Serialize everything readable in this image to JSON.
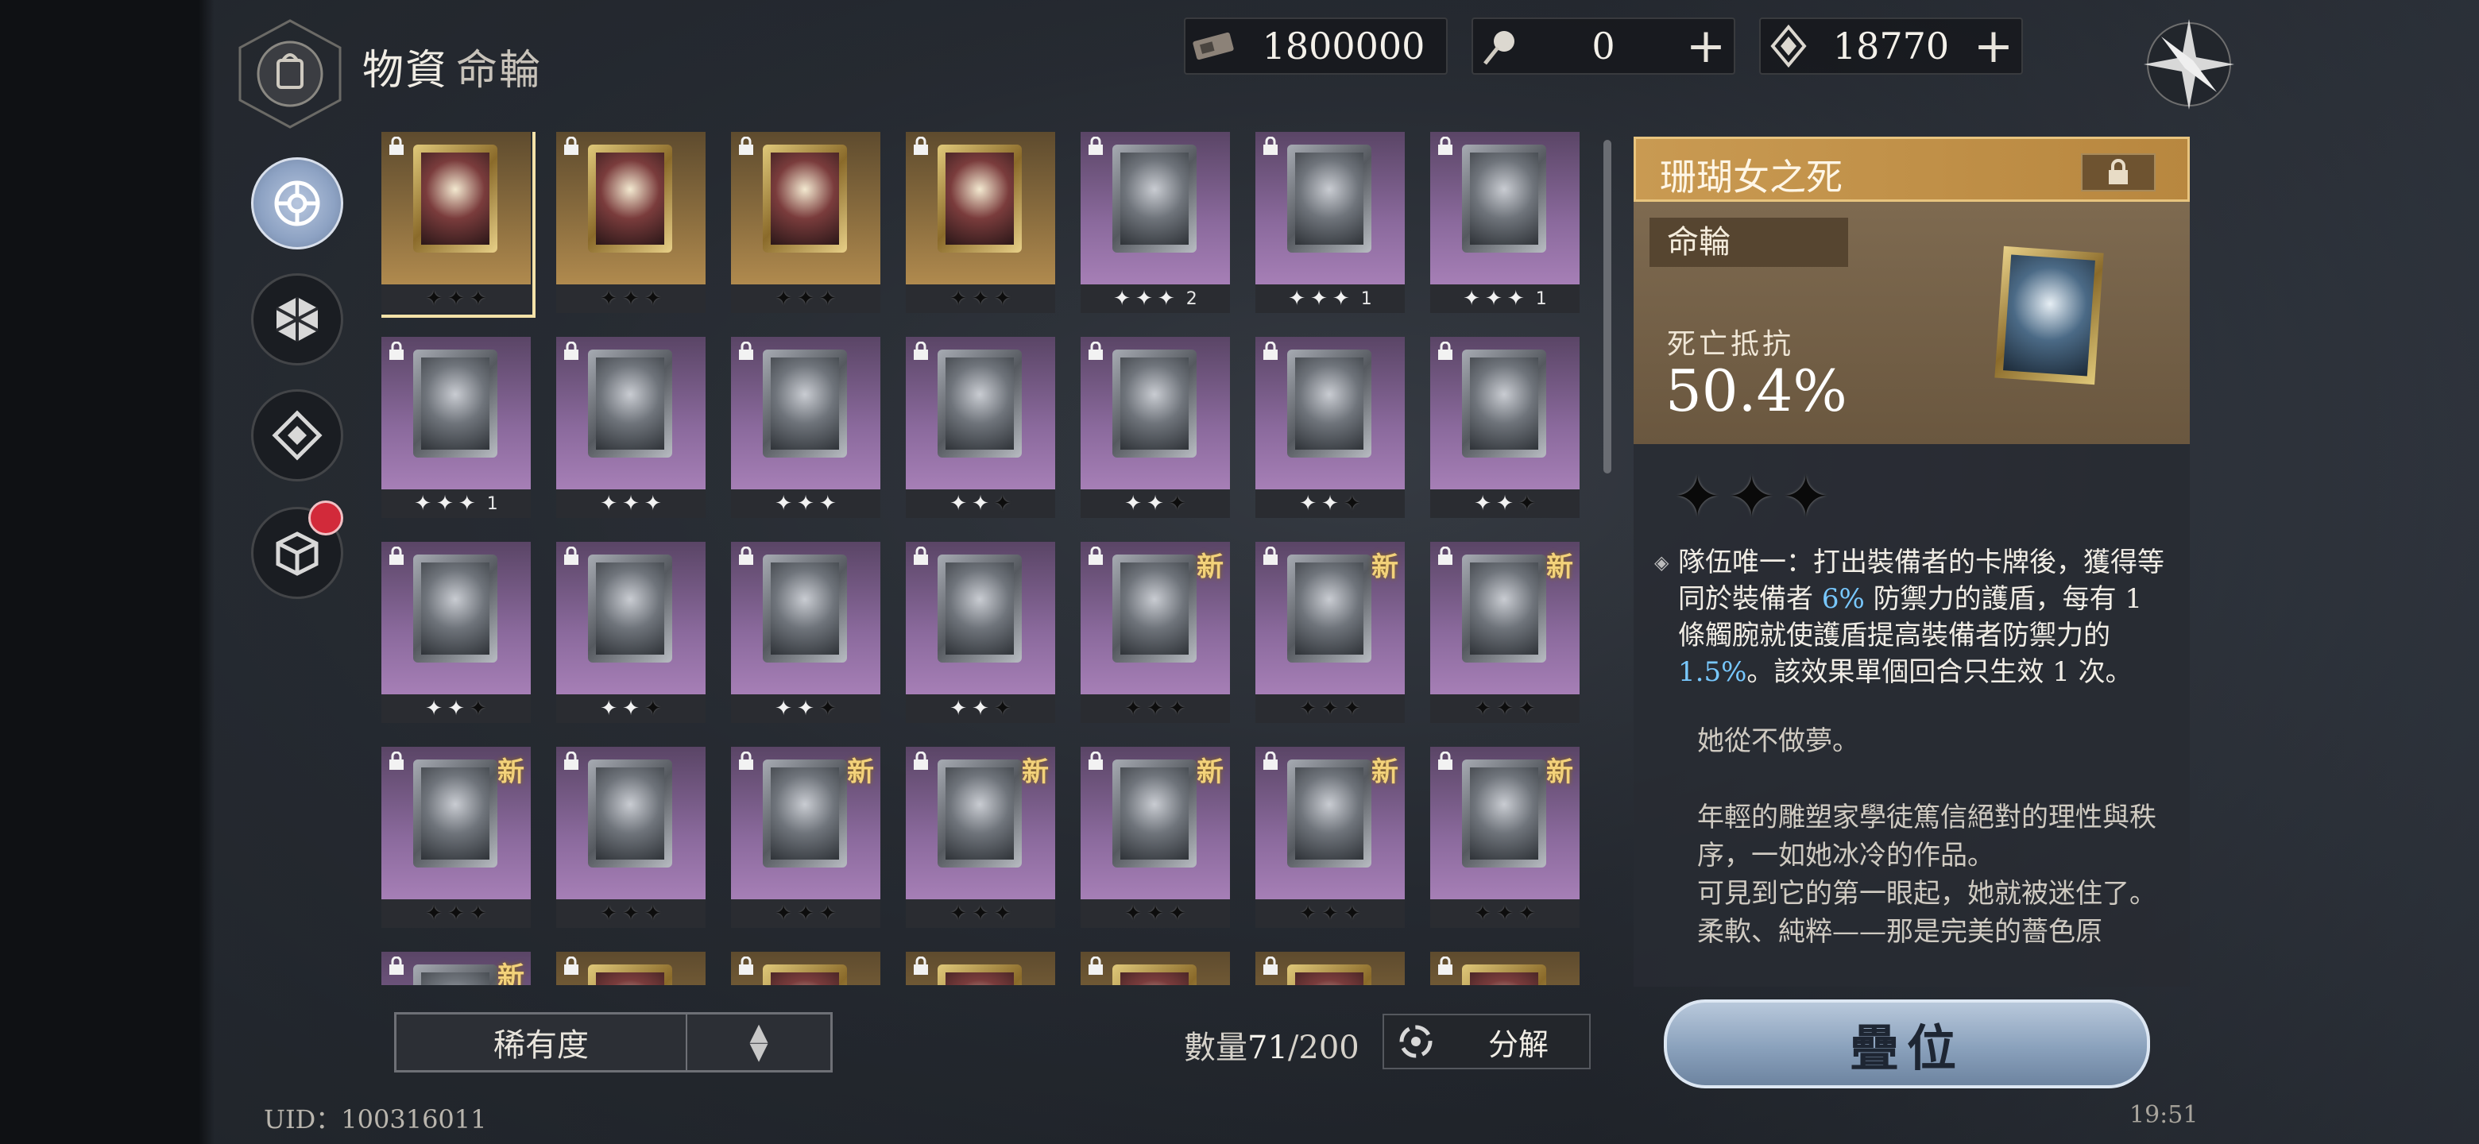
{
  "header": {
    "title": "物資",
    "subtitle": "命輪",
    "currencies": [
      {
        "icon": "ticket-icon",
        "value": "1800000",
        "has_plus": false
      },
      {
        "icon": "orb-icon",
        "value": "0",
        "has_plus": true
      },
      {
        "icon": "crystal-icon",
        "value": "18770",
        "has_plus": true
      }
    ]
  },
  "cards": [
    {
      "rarity": "gold",
      "stars": "✦✦✦",
      "count": "",
      "new": false,
      "selected": true,
      "icon": "coral-tree-icon"
    },
    {
      "rarity": "gold",
      "stars": "✦✦✦",
      "count": "",
      "new": false,
      "icon": "dice-plate-icon"
    },
    {
      "rarity": "gold",
      "stars": "✦✦✦",
      "count": "",
      "new": false,
      "icon": "winged-sword-icon"
    },
    {
      "rarity": "gold",
      "stars": "✦✦✦",
      "count": "",
      "new": false,
      "icon": "arched-door-icon"
    },
    {
      "rarity": "purple",
      "stars": "✧✧✧",
      "count": "2",
      "new": false,
      "icon": "cloth-icon"
    },
    {
      "rarity": "purple",
      "stars": "✧✧✧",
      "count": "1",
      "new": false,
      "icon": "box-icon"
    },
    {
      "rarity": "purple",
      "stars": "✧✧✧",
      "count": "1",
      "new": false,
      "icon": "bundle-icon"
    },
    {
      "rarity": "purple",
      "stars": "✧✧✧",
      "count": "1",
      "new": false,
      "icon": "arm-icon"
    },
    {
      "rarity": "purple",
      "stars": "✧✧✧",
      "count": "",
      "new": false,
      "icon": "claw-icon"
    },
    {
      "rarity": "purple",
      "stars": "✧✧✧",
      "count": "",
      "new": false,
      "icon": "papers-icon"
    },
    {
      "rarity": "purple",
      "stars": "✧✧✦",
      "count": "",
      "new": false,
      "icon": "goblets-icon"
    },
    {
      "rarity": "purple",
      "stars": "✧✧✦",
      "count": "",
      "new": false,
      "icon": "staff-icon"
    },
    {
      "rarity": "purple",
      "stars": "✧✧✦",
      "count": "",
      "new": false,
      "icon": "flower-icon"
    },
    {
      "rarity": "purple",
      "stars": "✧✧✦",
      "count": "",
      "new": false,
      "icon": "scepter-icon"
    },
    {
      "rarity": "purple",
      "stars": "✧✧✦",
      "count": "",
      "new": false,
      "icon": "crystal-icon"
    },
    {
      "rarity": "purple",
      "stars": "✧✧✦",
      "count": "",
      "new": false,
      "icon": "cat-icon"
    },
    {
      "rarity": "purple",
      "stars": "✧✧✦",
      "count": "",
      "new": false,
      "icon": "necklace-icon"
    },
    {
      "rarity": "purple",
      "stars": "✧✧✦",
      "count": "",
      "new": false,
      "icon": "hourglass-icon"
    },
    {
      "rarity": "purple",
      "stars": "✦✦✦",
      "count": "",
      "new": true,
      "icon": "necklace-icon"
    },
    {
      "rarity": "purple",
      "stars": "✦✦✦",
      "count": "",
      "new": true,
      "icon": "cloth-icon"
    },
    {
      "rarity": "purple",
      "stars": "✦✦✦",
      "count": "",
      "new": true,
      "icon": "cloth-icon"
    },
    {
      "rarity": "purple",
      "stars": "✦✦✦",
      "count": "",
      "new": true,
      "icon": "swirl-icon"
    },
    {
      "rarity": "purple",
      "stars": "✦✦✦",
      "count": "",
      "new": false,
      "icon": "target-icon"
    },
    {
      "rarity": "purple",
      "stars": "✦✦✦",
      "count": "",
      "new": true,
      "icon": "scepter-icon"
    },
    {
      "rarity": "purple",
      "stars": "✦✦✦",
      "count": "",
      "new": true,
      "icon": "bundle-icon"
    },
    {
      "rarity": "purple",
      "stars": "✦✦✦",
      "count": "",
      "new": true,
      "icon": "bundle-icon"
    },
    {
      "rarity": "purple",
      "stars": "✦✦✦",
      "count": "",
      "new": true,
      "icon": "cat-icon"
    },
    {
      "rarity": "purple",
      "stars": "✦✦✦",
      "count": "",
      "new": true,
      "icon": "arm-icon"
    },
    {
      "rarity": "purple",
      "stars": "",
      "count": "",
      "new": true,
      "icon": "frame-icon"
    },
    {
      "rarity": "gold",
      "stars": "",
      "count": "",
      "new": false,
      "icon": "frame-icon"
    },
    {
      "rarity": "gold",
      "stars": "",
      "count": "",
      "new": false,
      "icon": "frame-icon"
    },
    {
      "rarity": "gold",
      "stars": "",
      "count": "",
      "new": false,
      "icon": "frame-icon"
    },
    {
      "rarity": "gold",
      "stars": "",
      "count": "",
      "new": false,
      "icon": "frame-icon"
    },
    {
      "rarity": "gold",
      "stars": "",
      "count": "",
      "new": false,
      "icon": "frame-icon"
    },
    {
      "rarity": "gold",
      "stars": "",
      "count": "",
      "new": false,
      "icon": "frame-icon"
    }
  ],
  "new_label": "新",
  "bottom": {
    "sort_label": "稀有度",
    "quantity_label": "數量",
    "quantity_current": "71",
    "quantity_max": "/200",
    "decompose_label": "分解",
    "uid": "UID：100316011",
    "clock": "19:51"
  },
  "detail": {
    "name": "珊瑚女之死",
    "type": "命輪",
    "stat_label": "死亡抵抗",
    "stat_value": "50.4%",
    "stars": "✦✦✦",
    "effect_parts": [
      "隊伍唯一：打出裝備者的卡牌後，獲得等同於裝備者 ",
      "6%",
      " 防禦力的護盾，每有 1 條觸腕就使護盾提高裝備者防禦力的 ",
      "1.5%",
      "。該效果單個回合只生效 1 次。"
    ],
    "flavor": [
      "她從不做夢。",
      "",
      "年輕的雕塑家學徒篤信絕對的理性與秩序，一如她冰冷的作品。",
      "可見到它的第一眼起，她就被迷住了。",
      "柔軟、純粹——那是完美的薔色原"
    ],
    "stack_label": "疊位"
  },
  "colors": {
    "gold_card": "#b08a4e",
    "purple_card": "#a67fb6",
    "highlight": "#78c8ff",
    "alert": "#d22a3a"
  }
}
